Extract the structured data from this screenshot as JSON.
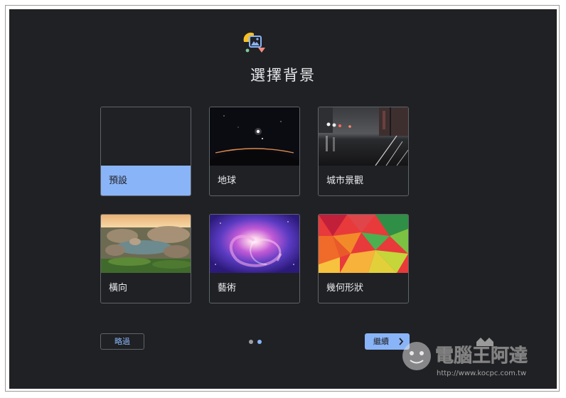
{
  "page": {
    "title": "選擇背景"
  },
  "options": [
    {
      "label": "預設",
      "selected": true
    },
    {
      "label": "地球",
      "selected": false
    },
    {
      "label": "城市景觀",
      "selected": false
    },
    {
      "label": "橫向",
      "selected": false
    },
    {
      "label": "藝術",
      "selected": false
    },
    {
      "label": "幾何形狀",
      "selected": false
    }
  ],
  "footer": {
    "skip_label": "略過",
    "next_label": "繼續",
    "pages_total": 2,
    "current_page": 2
  },
  "watermark": {
    "brand": "電腦王阿達",
    "url": "http://www.kocpc.com.tw"
  },
  "colors": {
    "background": "#202124",
    "accent": "#8ab4f8",
    "border": "#5f6368",
    "text": "#e8eaed"
  }
}
